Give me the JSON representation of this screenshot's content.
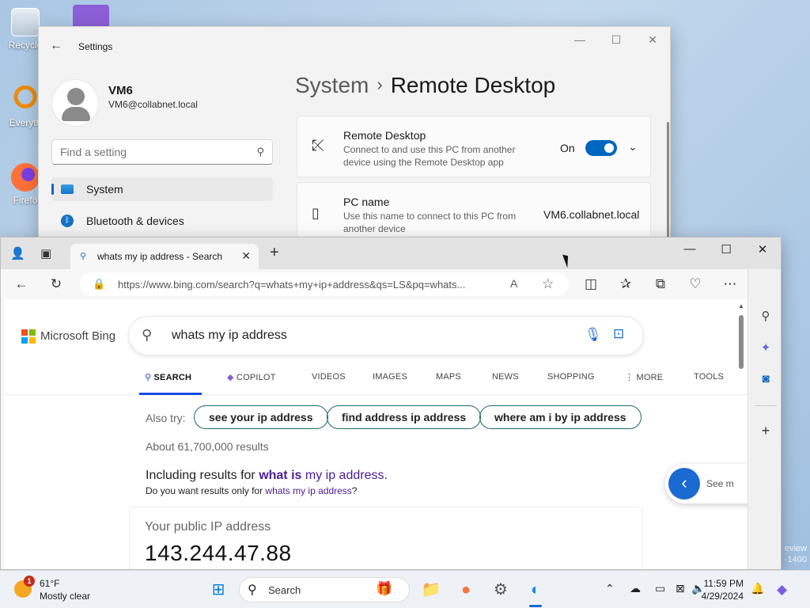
{
  "desktop": {
    "icons": [
      {
        "label": "Recycle",
        "icon": "recycle-bin-icon"
      },
      {
        "label": "Everyth",
        "icon": "everything-search-icon"
      },
      {
        "label": "Firefo",
        "icon": "firefox-icon"
      }
    ],
    "watermark": [
      "eview",
      "-1400"
    ]
  },
  "settings": {
    "title": "Settings",
    "user_name": "VM6",
    "user_email": "VM6@collabnet.local",
    "find_placeholder": "Find a setting",
    "nav": [
      {
        "label": "System",
        "icon": "monitor-icon",
        "active": true
      },
      {
        "label": "Bluetooth & devices",
        "icon": "bluetooth-icon",
        "active": false
      }
    ],
    "breadcrumb_parent": "System",
    "breadcrumb_sep": "›",
    "breadcrumb_current": "Remote Desktop",
    "remote_desktop": {
      "title": "Remote Desktop",
      "desc": "Connect to and use this PC from another device using the Remote Desktop app",
      "state": "On",
      "enabled": true
    },
    "pc_name": {
      "title": "PC name",
      "desc": "Use this name to connect to this PC from another device",
      "value": "VM6.collabnet.local"
    }
  },
  "edge": {
    "tab_title": "whats my ip address - Search",
    "url": "https://www.bing.com/search?q=whats+my+ip+address&qs=LS&pq=whats...",
    "bing": {
      "brand": "Microsoft Bing",
      "query": "whats my ip address",
      "scopes": [
        "SEARCH",
        "COPILOT",
        "VIDEOS",
        "IMAGES",
        "MAPS",
        "NEWS",
        "SHOPPING",
        "MORE",
        "TOOLS"
      ],
      "also_try_label": "Also try:",
      "also_try": [
        "see your ip address",
        "find address ip address",
        "where am i by ip address"
      ],
      "results_count": "About 61,700,000 results",
      "including_prefix": "Including results for ",
      "including_q1": "what is",
      "including_q2": " my ip address.",
      "dywant_prefix": "Do you want results only for ",
      "dywant_link": "whats my ip address",
      "dywant_suffix": "?",
      "ip_label": "Your public IP address",
      "ip_value": "143.244.47.88",
      "see_more": "See m"
    }
  },
  "taskbar": {
    "weather_badge": "1",
    "temperature": "61°F",
    "condition": "Mostly clear",
    "search_label": "Search",
    "time": "11:59 PM",
    "date": "4/29/2024"
  },
  "colors": {
    "accent": "#0067c0",
    "bing_link": "#4a1d96",
    "bing_blue": "#174ae4"
  }
}
